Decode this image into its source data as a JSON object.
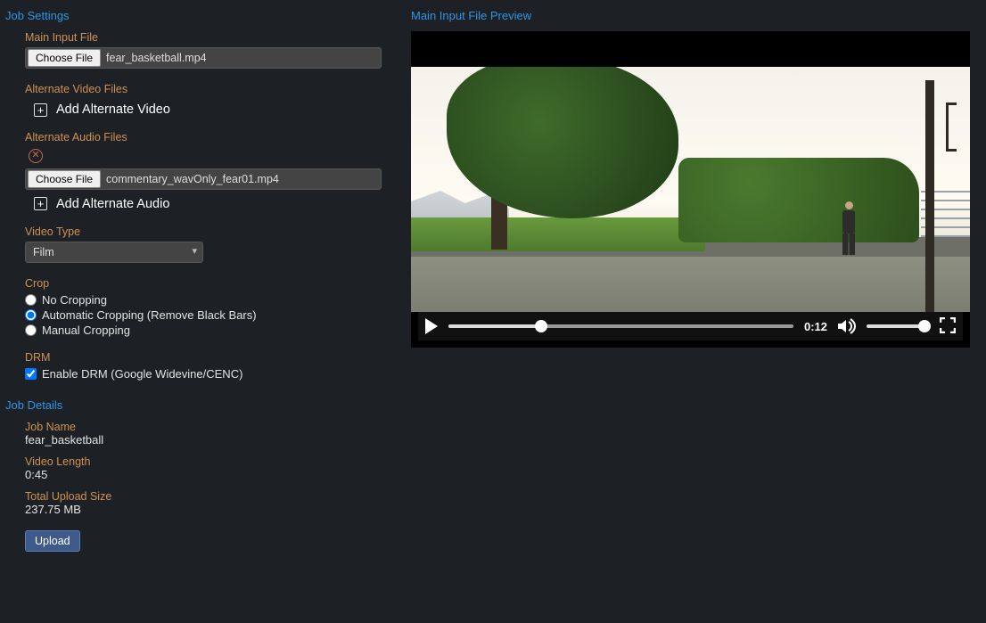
{
  "headings": {
    "job_settings": "Job Settings",
    "job_details": "Job Details",
    "preview": "Main Input File Preview"
  },
  "labels": {
    "main_input_file": "Main Input File",
    "alternate_video_files": "Alternate Video Files",
    "alternate_audio_files": "Alternate Audio Files",
    "video_type": "Video Type",
    "crop": "Crop",
    "drm": "DRM",
    "job_name": "Job Name",
    "video_length": "Video Length",
    "total_upload_size": "Total Upload Size"
  },
  "buttons": {
    "choose_file": "Choose File",
    "add_alternate_video": "Add Alternate Video",
    "add_alternate_audio": "Add Alternate Audio",
    "upload": "Upload"
  },
  "files": {
    "main_input": "fear_basketball.mp4",
    "alt_audio_0": "commentary_wavOnly_fear01.mp4"
  },
  "video_type_selected": "Film",
  "crop_options": {
    "none": "No Cropping",
    "auto": "Automatic Cropping (Remove Black Bars)",
    "manual": "Manual Cropping"
  },
  "drm_option": "Enable DRM (Google Widevine/CENC)",
  "details": {
    "job_name": "fear_basketball",
    "video_length": "0:45",
    "total_upload_size": "237.75 MB"
  },
  "player": {
    "time": "0:12"
  }
}
